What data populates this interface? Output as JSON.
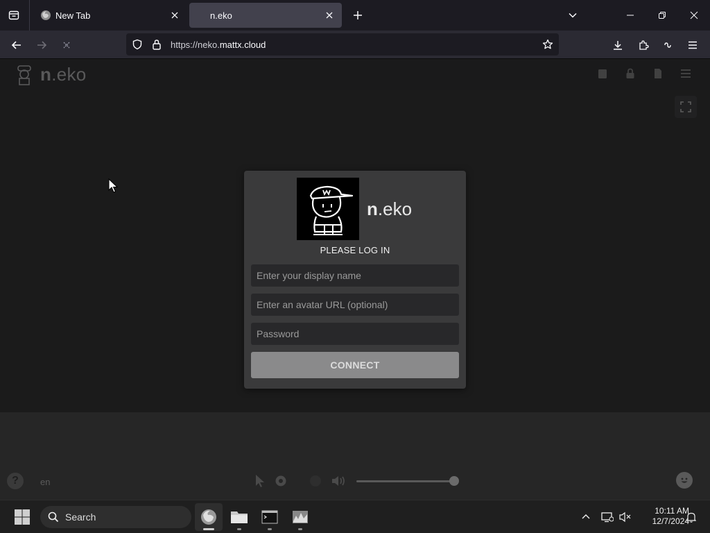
{
  "browser": {
    "tabs": [
      {
        "title": "New Tab",
        "active": false
      },
      {
        "title": "n.eko",
        "active": true
      }
    ],
    "url": {
      "prefix": "https://neko.",
      "domain": "mattx.cloud"
    }
  },
  "neko": {
    "brand_bold": "n",
    "brand_rest": ".eko",
    "language": "en"
  },
  "login": {
    "brand_bold": "n",
    "brand_rest": ".eko",
    "title": "PLEASE LOG IN",
    "display_name_placeholder": "Enter your display name",
    "avatar_placeholder": "Enter an avatar URL (optional)",
    "password_placeholder": "Password",
    "connect_label": "CONNECT"
  },
  "taskbar": {
    "search_label": "Search",
    "apps": [
      "firefox-icon",
      "file-explorer-icon",
      "terminal-icon",
      "task-manager-icon"
    ],
    "clock_time": "10:11 AM",
    "clock_date": "12/7/2024"
  },
  "colors": {
    "page_bg": "#1e1e1f",
    "card_bg": "#3a3a3b",
    "connect_bg": "#8a8a8b",
    "browser_chrome": "#2b2a33"
  }
}
